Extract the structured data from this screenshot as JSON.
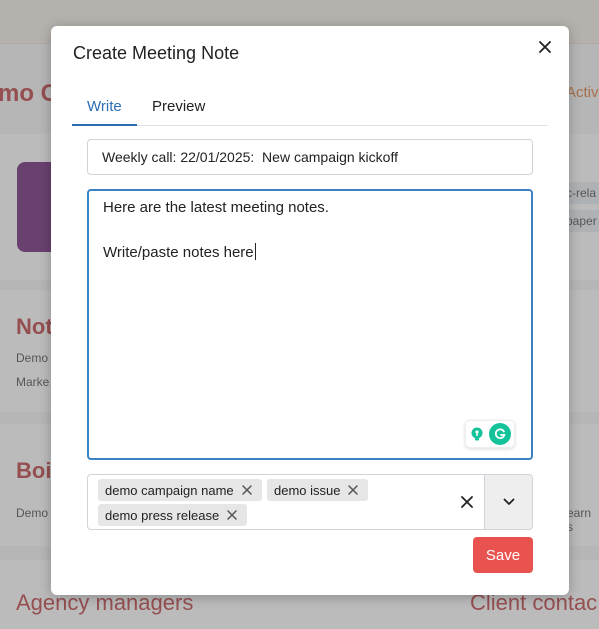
{
  "background": {
    "page_title_fragment": "mo C",
    "right_tab_fragment": "Activ",
    "tags": [
      "c-rela",
      "paper"
    ],
    "section_notes": "Not",
    "notes_lines": [
      "Demo",
      "Marke"
    ],
    "section_board": "Boi",
    "board_line": "Demo",
    "board_right": "earn s",
    "agency_managers": "Agency managers",
    "client_contacts": "Client contac"
  },
  "modal": {
    "title": "Create Meeting Note",
    "close_icon": "close-icon",
    "tabs": [
      {
        "label": "Write",
        "active": true
      },
      {
        "label": "Preview",
        "active": false
      }
    ],
    "title_input": {
      "value": "Weekly call: 22/01/2025:  New campaign kickoff"
    },
    "notes": {
      "lines": [
        "Here are the latest meeting notes.",
        "",
        "Write/paste notes here"
      ]
    },
    "tags": [
      {
        "label": "demo campaign name"
      },
      {
        "label": "demo issue"
      },
      {
        "label": "demo press release"
      }
    ],
    "save_label": "Save"
  },
  "colors": {
    "accent": "#2b6cb0",
    "save": "#e8534f",
    "brand_red": "#b3262b",
    "grammarly": "#15c39a"
  }
}
